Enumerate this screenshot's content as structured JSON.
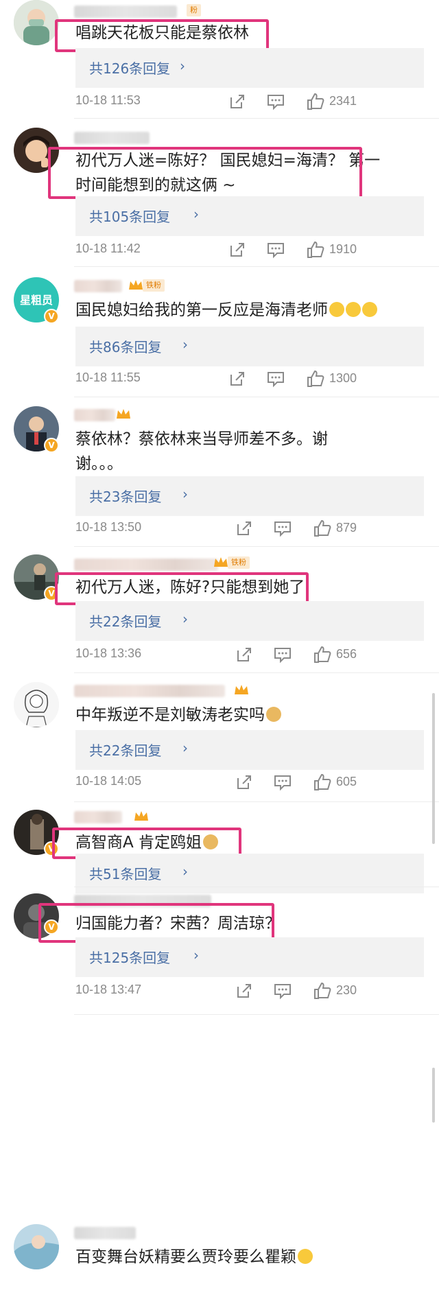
{
  "comments": [
    {
      "text": "唱跳天花板只能是蔡依林",
      "replies": "共126条回复",
      "time": "10-18 11:53",
      "likes": "2341",
      "badge": "粉"
    },
    {
      "text": "初代万人迷=陈好？ 国民媳妇=海清？ 第一时间能想到的就这俩 ~",
      "line1": "初代万人迷=陈好？ 国民媳妇=海清？ 第一",
      "line2": "时间能想到的就这俩 ~",
      "replies": "共105条回复",
      "time": "10-18 11:42",
      "likes": "1910"
    },
    {
      "text": "国民媳妇给我的第一反应是海清老师",
      "replies": "共86条回复",
      "time": "10-18 11:55",
      "likes": "1300",
      "badge": "铁粉",
      "avatar_text": "星粗员"
    },
    {
      "line1": "蔡依林？蔡依林来当导师差不多。谢",
      "line2": "谢。。。",
      "replies": "共23条回复",
      "time": "10-18 13:50",
      "likes": "879"
    },
    {
      "text": "初代万人迷，陈好?只能想到她了",
      "replies": "共22条回复",
      "time": "10-18 13:36",
      "likes": "656",
      "badge": "铁粉"
    },
    {
      "text": "中年叛逆不是刘敏涛老实吗",
      "replies": "共22条回复",
      "time": "10-18 14:05",
      "likes": "605"
    },
    {
      "text": "高智商A 肯定鸥姐",
      "replies": "共51条回复",
      "time": "",
      "likes": ""
    },
    {
      "text": "归国能力者？宋茜？周洁琼？",
      "replies": "共125条回复",
      "time": "10-18 13:47",
      "likes": "230"
    },
    {
      "text": "百变舞台妖精要么贾玲要么瞿颖"
    }
  ],
  "colors": {
    "highlight": "#e0357c",
    "reply_link": "#4a6fa5",
    "meta": "#8a8a8a"
  },
  "icons": [
    "share-icon",
    "comment-icon",
    "like-icon",
    "crown-icon",
    "verified-icon"
  ]
}
